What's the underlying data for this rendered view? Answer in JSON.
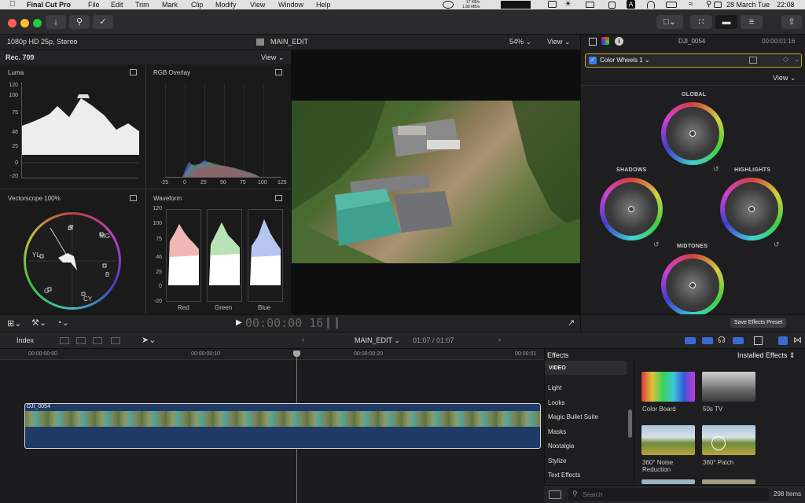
{
  "menubar": {
    "app": "Final Cut Pro",
    "items": [
      "File",
      "Edit",
      "Trim",
      "Mark",
      "Clip",
      "Modify",
      "View",
      "Window",
      "Help"
    ],
    "net_up": "17 KB/s",
    "net_down": "1.88 MB/s",
    "date": "28 March Tue",
    "time": "22:08"
  },
  "viewer": {
    "format": "1080p HD 25p, Stereo",
    "title": "MAIN_EDIT",
    "zoom": "54%",
    "view": "View",
    "timecode": "00:00:00 16"
  },
  "scopes": {
    "colorspace": "Rec. 709",
    "view": "View",
    "luma": "Luma",
    "rgb_overlay": "RGB Overlay",
    "vectorscope": "Vectorscope 100%",
    "waveform": "Waveform",
    "luma_ticks": [
      "120",
      "100",
      "75",
      "46",
      "25",
      "0",
      "-20"
    ],
    "rgb_ticks": [
      "-25",
      "0",
      "25",
      "50",
      "75",
      "100",
      "125"
    ],
    "wave_ticks": [
      "120",
      "100",
      "75",
      "46",
      "25",
      "0",
      "-20"
    ],
    "channels": [
      "Red",
      "Green",
      "Blue"
    ],
    "vec_labels": [
      "R",
      "MG",
      "B",
      "CY",
      "G",
      "YL"
    ]
  },
  "inspector": {
    "clip": "DJI_0054",
    "duration": "00:00:01:16",
    "effect": "Color Wheels 1",
    "view": "View",
    "wheels": [
      "GLOBAL",
      "SHADOWS",
      "HIGHLIGHTS",
      "MIDTONES"
    ],
    "save_preset": "Save Effects Preset"
  },
  "timeline": {
    "index": "Index",
    "project": "MAIN_EDIT",
    "position": "01:07 / 01:07",
    "ruler": [
      "00:00:00:00",
      "00:00:00:10",
      "00:00:00:20",
      "00:00:01"
    ],
    "clip_name": "DJI_0054"
  },
  "effects": {
    "title": "Effects",
    "installed": "Installed Effects",
    "section": "VIDEO",
    "categories": [
      "Light",
      "Looks",
      "Magic Bullet Suite",
      "Masks",
      "Nostalgia",
      "Stylize",
      "Text Effects"
    ],
    "items": [
      "Color Board",
      "50s TV",
      "360° Noise Reduction",
      "360° Patch"
    ],
    "search_placeholder": "Search",
    "count": "298 Items"
  },
  "colors": {
    "accent": "#f5c542",
    "clip_blue": "#1f3a66",
    "timeline_bg": "#232325"
  }
}
